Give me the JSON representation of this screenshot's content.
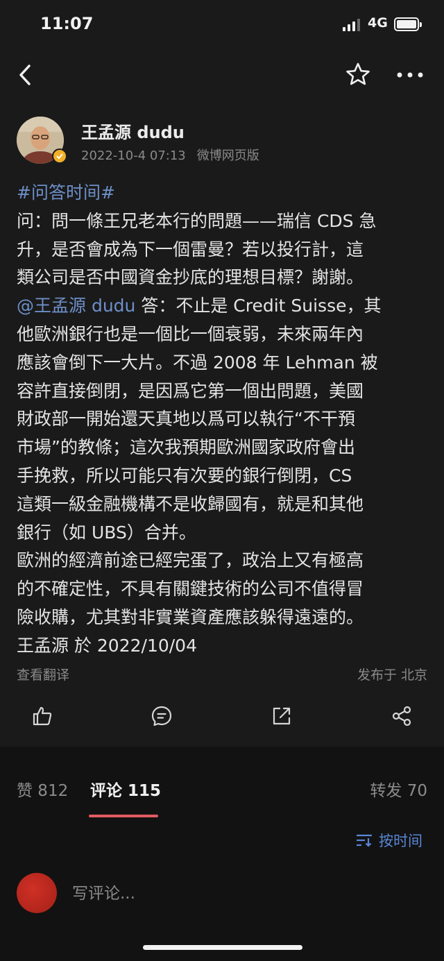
{
  "status_bar": {
    "time": "11:07",
    "network": "4G",
    "battery_level": 1.0
  },
  "nav": {
    "back_icon": "chevron-left-icon",
    "favorite_icon": "star-icon",
    "more_icon": "more-icon"
  },
  "post": {
    "author": "王孟源 dudu",
    "verified_badge_color": "#f2b02a",
    "date": "2022-10-4 07:13",
    "source": "微博网页版",
    "lines": [
      "#问答时间#",
      "问：問一條王兄老本行的問題——瑞信 CDS 急",
      "升，是否會成為下一個雷曼？若以投行計，這",
      "類公司是否中國資金抄底的理想目標？謝謝。",
      "@王孟源 dudu",
      " 答：不止是 Credit Suisse，其",
      "他歐洲銀行也是一個比一個衰弱，未來兩年內",
      "應該會倒下一大片。不過 2008 年 Lehman 被",
      "容許直接倒閉，是因爲它第一個出問題，美國",
      "財政部一開始還天真地以爲可以執行“不干預",
      "市場”的教條；這次我預期歐洲國家政府會出",
      "手挽救，所以可能只有次要的銀行倒閉，CS",
      "這類一級金融機構不是收歸國有，就是和其他",
      "銀行（如 UBS）合并。",
      "歐洲的經濟前途已經完蛋了，政治上又有極高",
      "的不確定性，不具有關鍵技術的公司不值得冒",
      "險收購，尤其對非實業資產應該躲得遠遠的。",
      "王孟源 於 2022/10/04"
    ],
    "translate_label": "查看翻译",
    "location_label": "发布于 北京",
    "actions": [
      "like-icon",
      "comment-icon",
      "repost-icon",
      "share-icon"
    ],
    "link_color": "#6d8fc8"
  },
  "tabs": {
    "likes": "赞 812",
    "comments": "评论 115",
    "reposts": "转发 70",
    "active_color": "#e25b62"
  },
  "sort": {
    "label": "按时间",
    "icon": "sort-icon"
  },
  "comment_input": {
    "placeholder": "写评论..."
  }
}
